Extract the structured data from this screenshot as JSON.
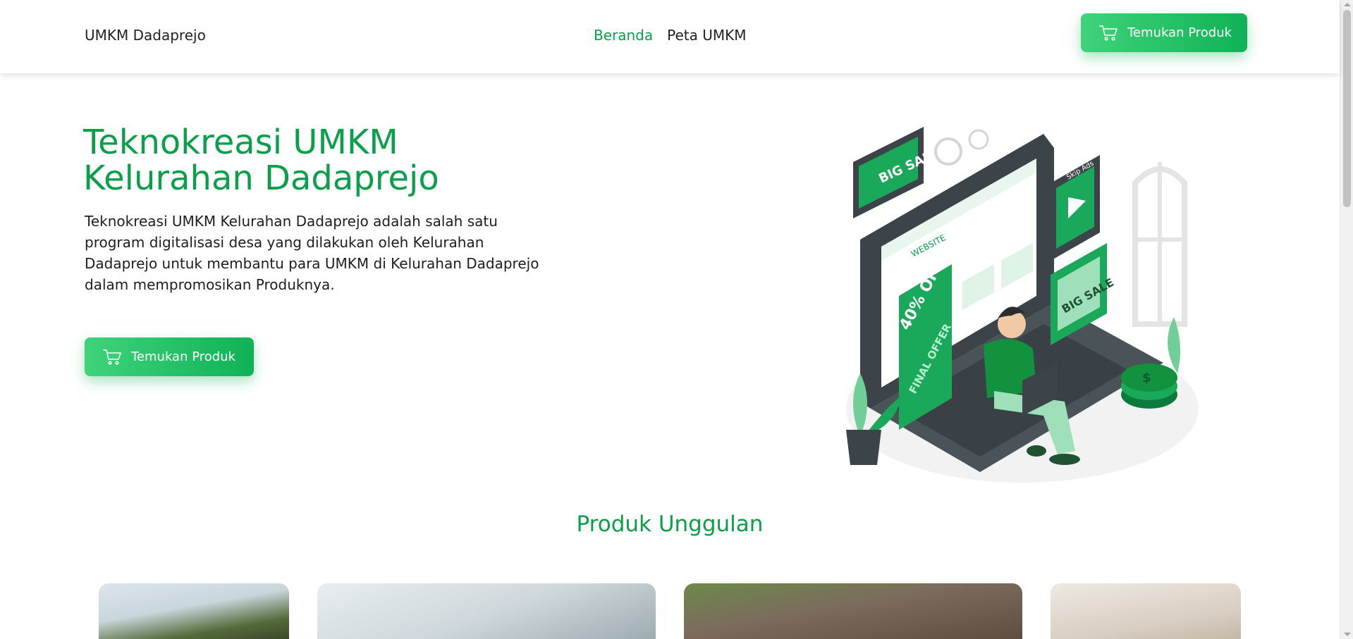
{
  "header": {
    "brand": "UMKM Dadaprejo",
    "nav": [
      {
        "label": "Beranda",
        "active": true
      },
      {
        "label": "Peta UMKM",
        "active": false
      }
    ],
    "cta_label": "Temukan Produk",
    "cta_icon": "cart-icon"
  },
  "hero": {
    "title_line1": "Teknokreasi UMKM",
    "title_line2": "Kelurahan Dadaprejo",
    "description": "Teknokreasi UMKM Kelurahan Dadaprejo adalah salah satu program digitalisasi desa yang dilakukan oleh Kelurahan Dadaprejo untuk membantu para UMKM di Kelurahan Dadaprejo dalam mempromosikan Produknya.",
    "cta_label": "Temukan Produk",
    "illustration": {
      "icon": "online-shopping-illustration",
      "texts": [
        "BIG SALE",
        "Skip Ads",
        "WEBSITE",
        "40% OFF",
        "FINAL OFFER",
        "BIG SALE"
      ]
    }
  },
  "section": {
    "title": "Produk Unggulan"
  },
  "colors": {
    "accent": "#0aa04a",
    "button_start": "#3fd37a",
    "button_end": "#10b257"
  }
}
